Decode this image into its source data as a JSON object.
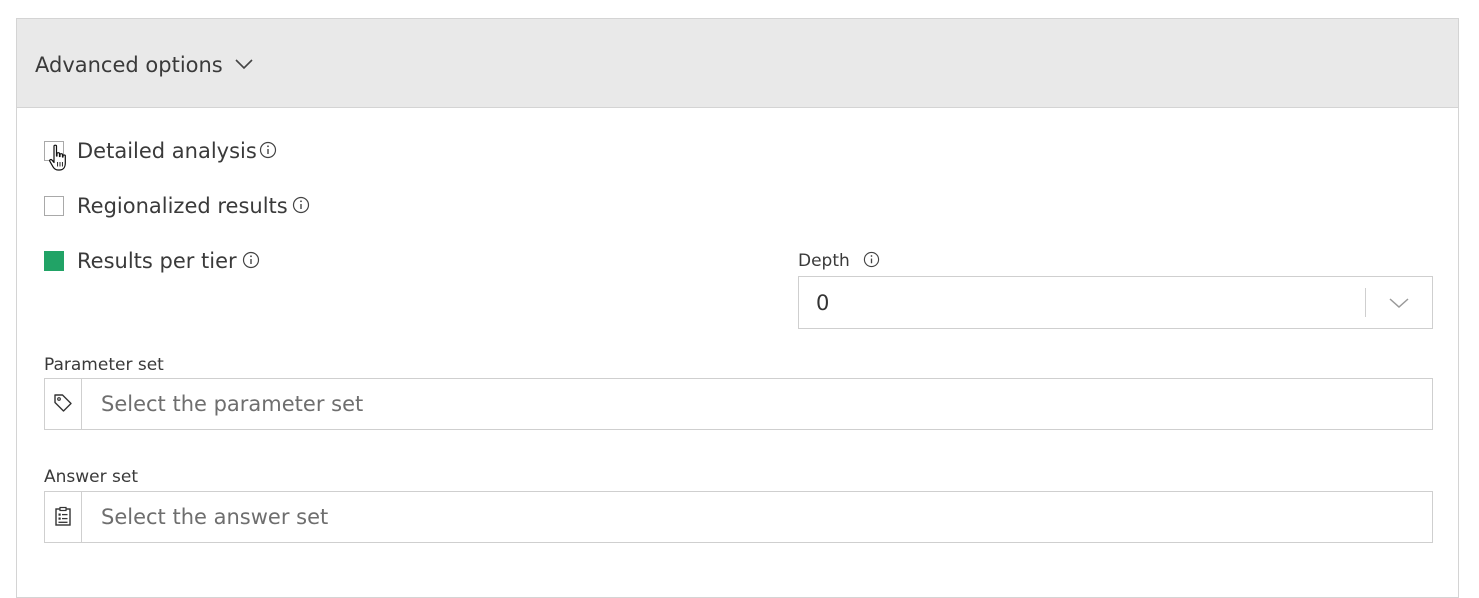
{
  "panel": {
    "title": "Advanced options",
    "expanded": true
  },
  "options": [
    {
      "label": "Detailed analysis",
      "checked": false
    },
    {
      "label": "Regionalized results",
      "checked": false
    },
    {
      "label": "Results per tier",
      "checked": true
    }
  ],
  "depth": {
    "label": "Depth",
    "value": "0"
  },
  "parameter_set": {
    "label": "Parameter set",
    "placeholder": "Select the parameter set",
    "value": "",
    "icon": "tag-icon"
  },
  "answer_set": {
    "label": "Answer set",
    "placeholder": "Select the answer set",
    "value": "",
    "icon": "clipboard-list-icon"
  },
  "colors": {
    "accent": "#21a366",
    "header_bg": "#e9e9e9",
    "border": "#cfcfcf"
  }
}
